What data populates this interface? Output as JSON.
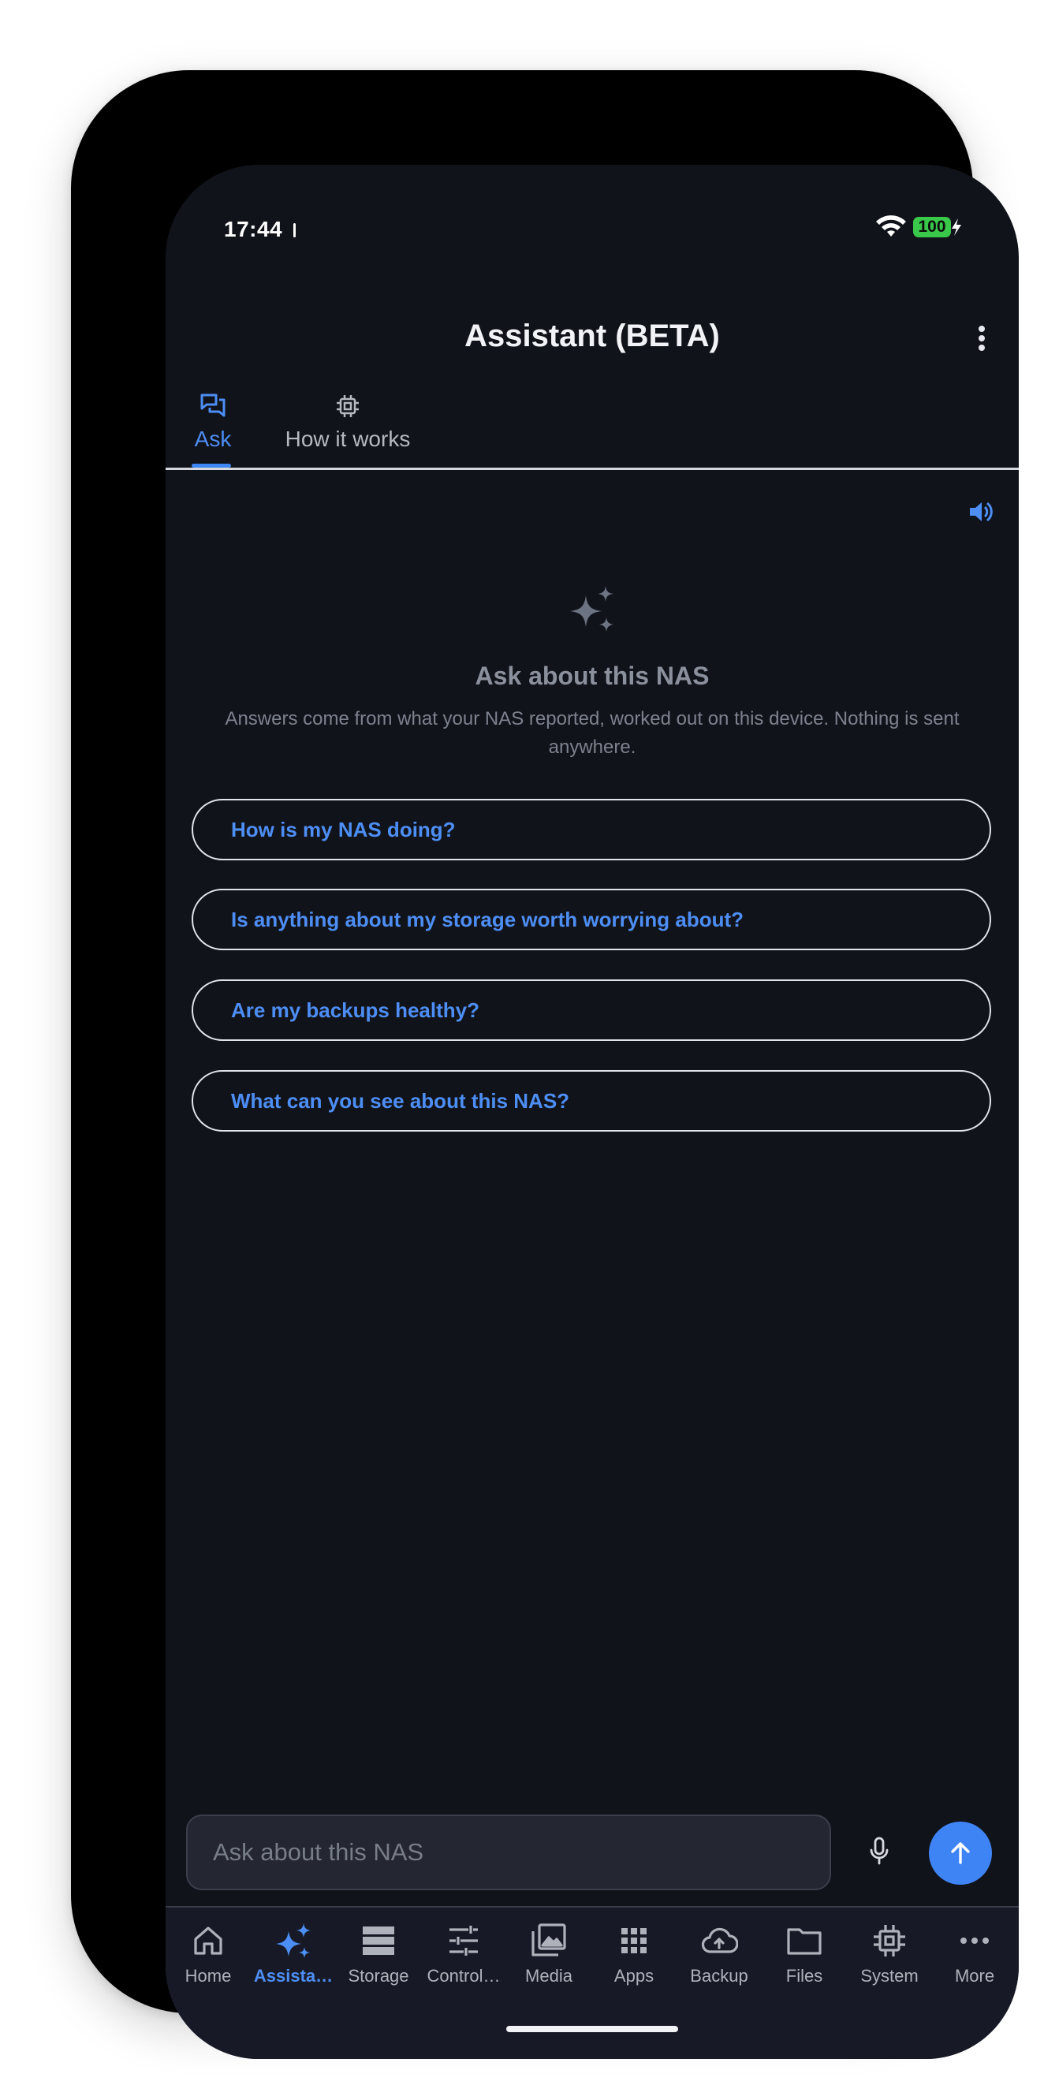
{
  "status_bar": {
    "time": "17:44",
    "battery": "100"
  },
  "app_bar": {
    "title": "Assistant (BETA)"
  },
  "tabs": [
    {
      "label": "Ask",
      "icon": "chat-bubbles-icon",
      "active": true
    },
    {
      "label": "How it works",
      "icon": "chip-icon",
      "active": false
    }
  ],
  "empty_state": {
    "icon": "sparkle-icon",
    "title": "Ask about this NAS",
    "subtitle": "Answers come from what your NAS reported, worked out on this device. Nothing is sent anywhere."
  },
  "suggestions": [
    "How is my NAS doing?",
    "Is anything about my storage worth worrying about?",
    "Are my backups healthy?",
    "What can you see about this NAS?"
  ],
  "composer": {
    "placeholder": "Ask about this NAS",
    "value": ""
  },
  "nav": [
    {
      "label": "Home",
      "icon": "home-icon",
      "active": false
    },
    {
      "label": "Assista…",
      "icon": "sparkle-icon",
      "active": true
    },
    {
      "label": "Storage",
      "icon": "storage-icon",
      "active": false
    },
    {
      "label": "Control…",
      "icon": "sliders-icon",
      "active": false
    },
    {
      "label": "Media",
      "icon": "photo-library-icon",
      "active": false
    },
    {
      "label": "Apps",
      "icon": "apps-grid-icon",
      "active": false
    },
    {
      "label": "Backup",
      "icon": "cloud-upload-icon",
      "active": false
    },
    {
      "label": "Files",
      "icon": "folder-icon",
      "active": false
    },
    {
      "label": "System",
      "icon": "chip-icon",
      "active": false
    },
    {
      "label": "More",
      "icon": "more-dots-icon",
      "active": false
    }
  ],
  "colors": {
    "accent": "#4d8ef5",
    "background": "#11131a",
    "nav_background": "#171a26"
  }
}
